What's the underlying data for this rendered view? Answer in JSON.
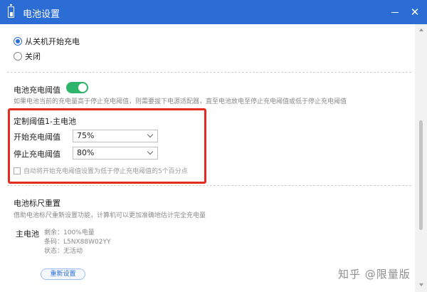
{
  "window": {
    "title": "电池设置"
  },
  "charge_mode": {
    "options": [
      {
        "label": "从关机开始充电",
        "checked": true
      },
      {
        "label": "关闭",
        "checked": false
      }
    ]
  },
  "threshold": {
    "title": "电池充电阈值",
    "enabled": true,
    "description": "如果电池当前的充电量高于停止充电阈值，则需要拔下电源适配器，直至电池放电至停止充电阈值或低于停止充电阈值"
  },
  "custom": {
    "title": "定制阈值1-主电池",
    "start_label": "开始充电阈值",
    "start_value": "75%",
    "stop_label": "停止充电阈值",
    "stop_value": "80%",
    "auto_checkbox_label": "自动将开始充电阈值设置为低于停止充电阈值的5个百分点",
    "auto_checked": false
  },
  "gauge_reset": {
    "title": "电池标尺重置",
    "description": "借助电池标尺重新设置功能，计算机可以更加准确地估计完全充电量",
    "battery_label": "主电池",
    "remaining": "剩余：100%电量",
    "barcode": "条码：L5NX88W02YY",
    "status": "状态：无活动",
    "button_label": "重新设置"
  },
  "watermark": "知乎 @限量版",
  "colors": {
    "titlebar": "#2b6dd5",
    "toggle_on": "#2fb46b",
    "highlight": "#e52a1f"
  }
}
